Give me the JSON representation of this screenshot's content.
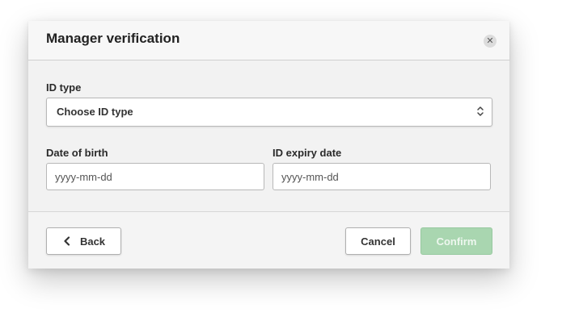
{
  "dialog": {
    "title": "Manager verification",
    "close_icon": "close-icon"
  },
  "form": {
    "id_type": {
      "label": "ID type",
      "selected": "Choose ID type",
      "icon": "select-chevron-icon"
    },
    "date_of_birth": {
      "label": "Date of birth",
      "value": "",
      "placeholder": "yyyy-mm-dd"
    },
    "id_expiry_date": {
      "label": "ID expiry date",
      "value": "",
      "placeholder": "yyyy-mm-dd"
    }
  },
  "footer": {
    "back_label": "Back",
    "back_icon": "chevron-left-icon",
    "cancel_label": "Cancel",
    "confirm_label": "Confirm",
    "confirm_enabled": false
  },
  "colors": {
    "confirm_disabled_bg": "#a9d6b0",
    "modal_bg": "#f4f4f4",
    "title_text": "#222222"
  }
}
